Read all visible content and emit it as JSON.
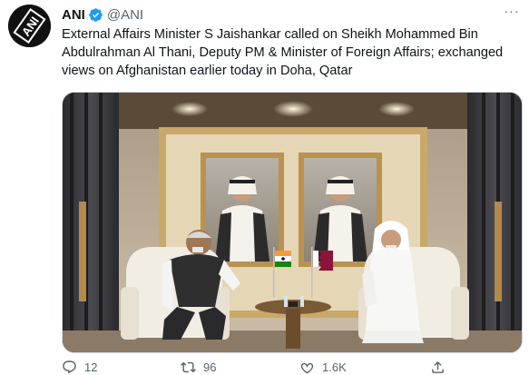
{
  "tweet": {
    "author_name": "ANI",
    "author_handle": "@ANI",
    "more_glyph": "···",
    "avatar_text": "ANI",
    "text": "External Affairs Minister S Jaishankar called on Sheikh Mohammed Bin Abdulrahman Al Thani, Deputy PM & Minister of Foreign Affairs; exchanged views on Afghanistan earlier today in Doha, Qatar",
    "replies": "12",
    "retweets": "96",
    "likes": "1.6K"
  },
  "colors": {
    "text_primary": "#0f1419",
    "text_secondary": "#536471",
    "verified_blue": "#1d9bf0",
    "qatar_maroon": "#8a1538"
  },
  "icons": [
    "verified-badge-icon",
    "more-icon",
    "reply-icon",
    "retweet-icon",
    "like-icon",
    "share-icon"
  ]
}
